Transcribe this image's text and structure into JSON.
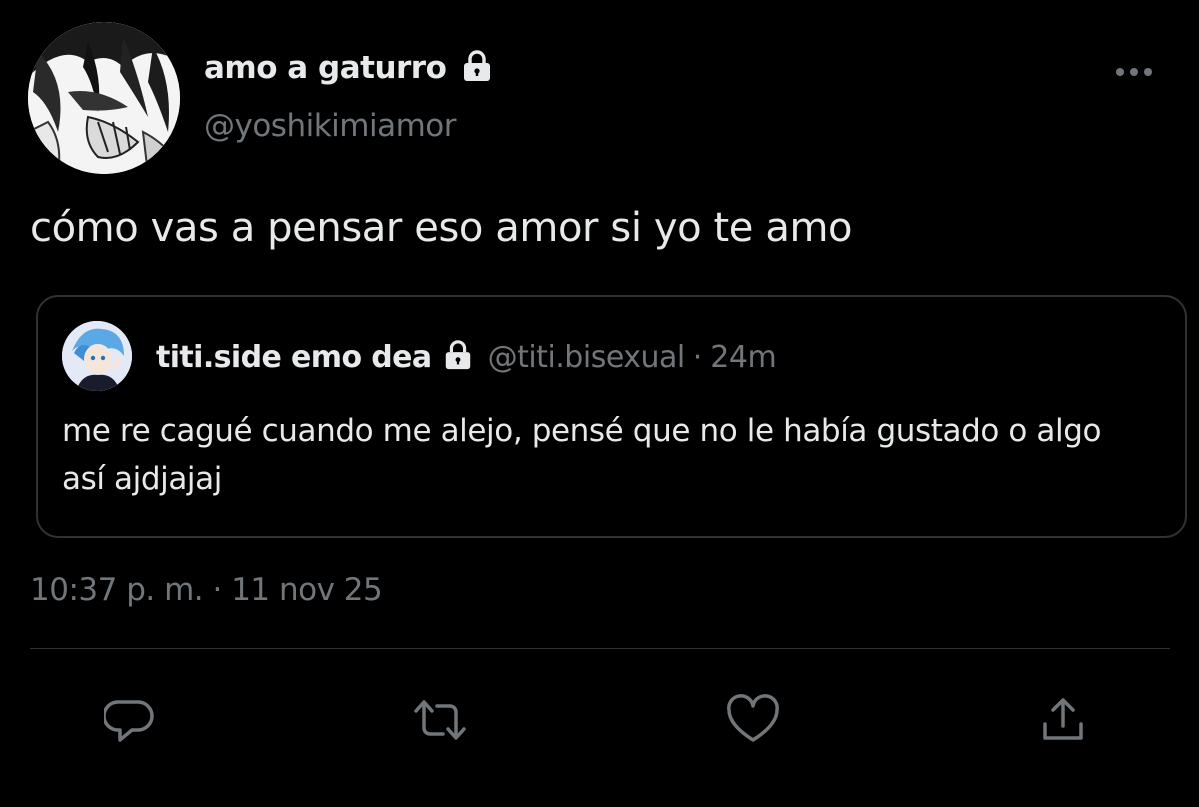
{
  "tweet": {
    "display_name": "amo a gaturro",
    "handle": "@yoshikimiamor",
    "text": "cómo vas a pensar eso amor si yo te amo",
    "timestamp": "10:37 p. m. · 11 nov 25",
    "protected_icon": "lock-icon",
    "more_icon": "more-icon"
  },
  "quote": {
    "display_name": "titi.side emo dea",
    "handle": "@titi.bisexual",
    "separator": "·",
    "time": "24m",
    "text": "me re cagué cuando me alejo, pensé que no le había gustado o algo así ajdjajaj",
    "protected_icon": "lock-icon"
  },
  "actions": [
    {
      "name": "reply",
      "icon": "reply-icon"
    },
    {
      "name": "retweet",
      "icon": "retweet-icon"
    },
    {
      "name": "like",
      "icon": "heart-icon"
    },
    {
      "name": "share",
      "icon": "share-icon"
    }
  ],
  "colors": {
    "background": "#000000",
    "text_primary": "#e7e9ea",
    "text_secondary": "#71767b",
    "border": "#2f3336"
  }
}
